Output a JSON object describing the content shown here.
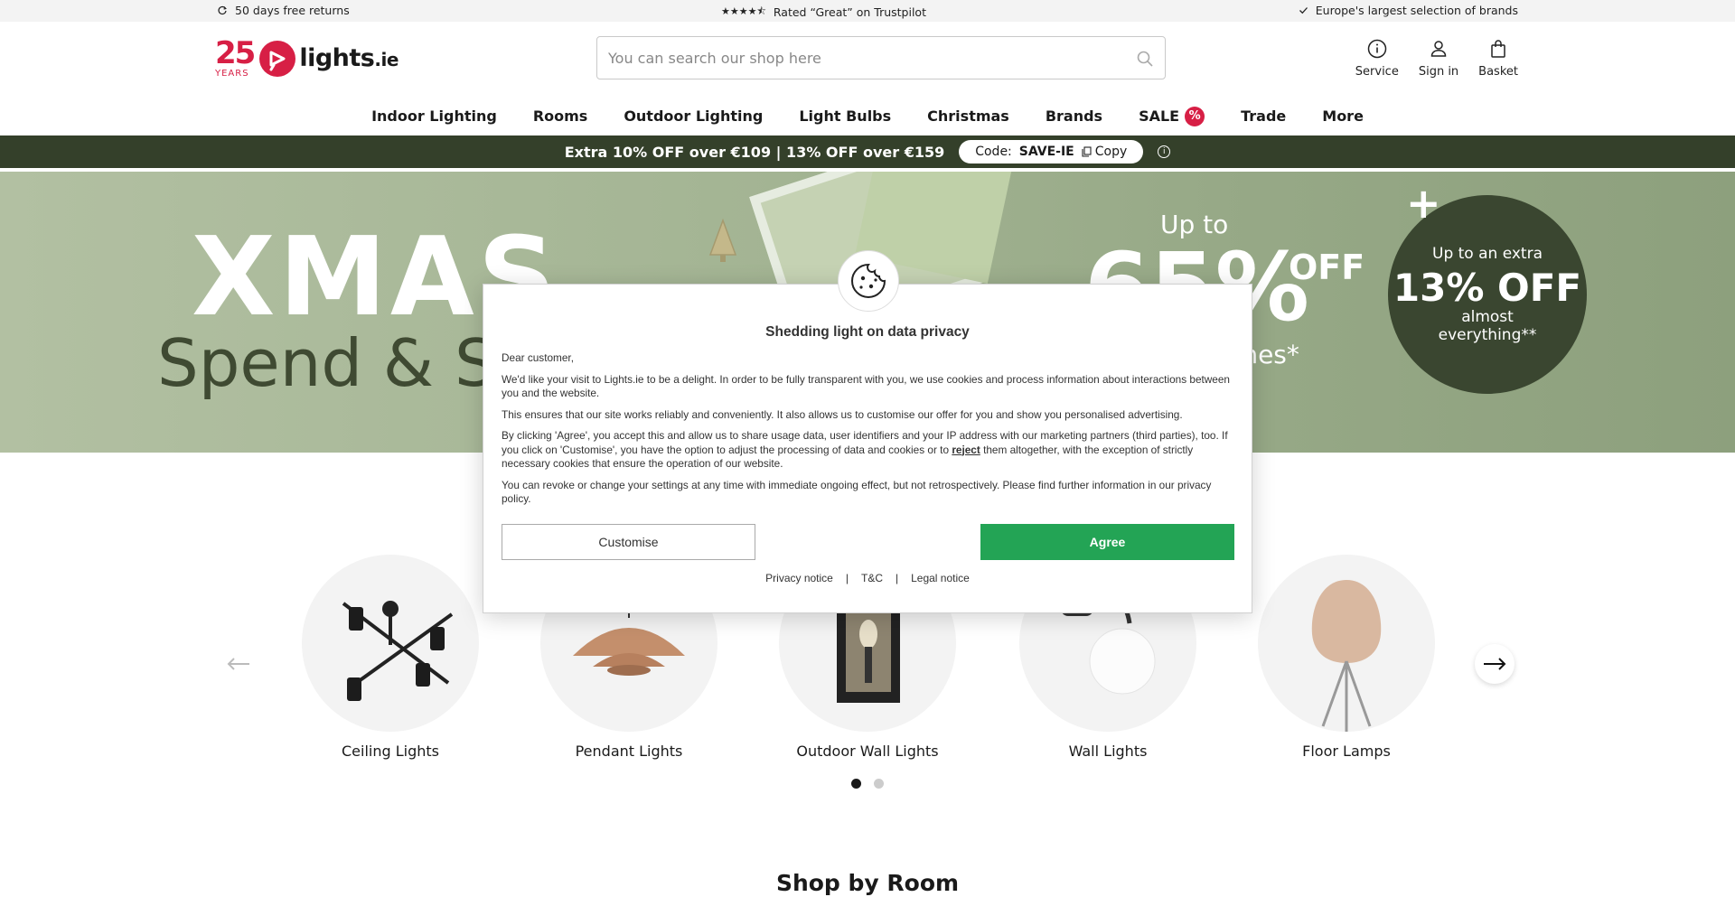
{
  "topbar": {
    "returns": "50 days free returns",
    "rating": "Rated “Great” on Trustpilot",
    "selection": "Europe's largest selection of brands",
    "stars": "★★★★⯪"
  },
  "header": {
    "logo_years_num": "25",
    "logo_years_label": "YEARS",
    "logo_name": "lights",
    "logo_tld": ".ie",
    "search_placeholder": "You can search our shop here",
    "actions": {
      "service": "Service",
      "signin": "Sign in",
      "basket": "Basket"
    }
  },
  "nav": {
    "items": [
      "Indoor Lighting",
      "Rooms",
      "Outdoor Lighting",
      "Light Bulbs",
      "Christmas",
      "Brands",
      "SALE",
      "Trade",
      "More"
    ],
    "sale_badge": "%"
  },
  "promo": {
    "text": "Extra 10% OFF over €109 | 13% OFF over €159",
    "code_label": "Code:",
    "code_value": "SAVE-IE",
    "copy_label": "Copy"
  },
  "hero": {
    "xmas": "XMAS",
    "spend": "Spend & Sa",
    "upto": "Up to",
    "pct": "65%",
    "off": "OFF",
    "lines": "f lines*",
    "badge_plus": "+",
    "badge_line1": "Up to an extra",
    "badge_line2": "13% OFF",
    "badge_line3": "almost",
    "badge_line4": "everything**"
  },
  "categories": [
    {
      "label": "Ceiling Lights"
    },
    {
      "label": "Pendant Lights"
    },
    {
      "label": "Outdoor Wall Lights"
    },
    {
      "label": "Wall Lights"
    },
    {
      "label": "Floor Lamps"
    }
  ],
  "carousel": {
    "active_page": 1,
    "pages": 2
  },
  "section": {
    "shop_by_room": "Shop by Room"
  },
  "cookie": {
    "title": "Shedding light on data privacy",
    "greeting": "Dear customer,",
    "p1": "We'd like your visit to Lights.ie to be a delight. In order to be fully transparent with you, we use cookies and process information about interactions between you and the website.",
    "p2": "This ensures that our site works reliably and conveniently. It also allows us to customise our offer for you and show you personalised advertising.",
    "p3_a": "By clicking 'Agree', you accept this and allow us to share usage data, user identifiers and your IP address with our marketing partners (third parties), too. If you click on 'Customise', you have the option to adjust the processing of data and cookies or to ",
    "p3_reject": "reject",
    "p3_b": " them altogether, with the exception of strictly necessary cookies that ensure the operation of our website.",
    "p4": "You can revoke or change your settings at any time with immediate ongoing effect, but not retrospectively. Please find further information in our privacy policy.",
    "customise": "Customise",
    "agree": "Agree",
    "links": [
      "Privacy notice",
      "T&C",
      "Legal notice"
    ],
    "link_sep": "|"
  },
  "colors": {
    "brand_red": "#d71f45",
    "promo_green": "#34402a",
    "agree_green": "#23a455"
  }
}
